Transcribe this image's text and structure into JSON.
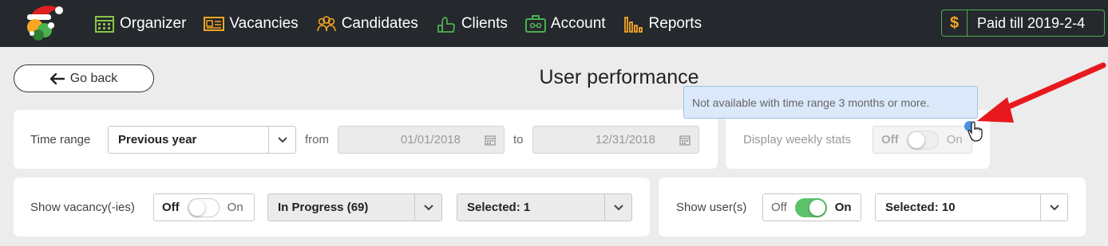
{
  "nav": {
    "items": [
      {
        "label": "Organizer",
        "icon": "calendar-icon"
      },
      {
        "label": "Vacancies",
        "icon": "id-card-icon"
      },
      {
        "label": "Candidates",
        "icon": "people-icon"
      },
      {
        "label": "Clients",
        "icon": "handshake-icon"
      },
      {
        "label": "Account",
        "icon": "briefcase-icon"
      },
      {
        "label": "Reports",
        "icon": "bar-chart-icon"
      }
    ],
    "paid_symbol": "$",
    "paid_label": "Paid till 2019-2-4"
  },
  "header": {
    "back_label": "Go back",
    "title": "User performance"
  },
  "time_range": {
    "label": "Time range",
    "selected": "Previous year",
    "from_label": "from",
    "from_value": "01/01/2018",
    "to_label": "to",
    "to_value": "12/31/2018"
  },
  "weekly": {
    "label": "Display weekly stats",
    "off": "Off",
    "on": "On",
    "state": "off",
    "disabled": true,
    "tooltip": "Not available with time range 3 months or more."
  },
  "vacancies": {
    "label": "Show vacancy(-ies)",
    "off": "Off",
    "on": "On",
    "state": "off",
    "status_selected": "In Progress (69)",
    "selected_label": "Selected: 1"
  },
  "users": {
    "label": "Show user(s)",
    "off": "Off",
    "on": "On",
    "state": "on",
    "selected_label": "Selected: 10"
  },
  "colors": {
    "topbar": "#25282c",
    "accent_green": "#5cc36b",
    "tooltip_bg": "#dbe9fb",
    "arrow_red": "#e8191e"
  }
}
